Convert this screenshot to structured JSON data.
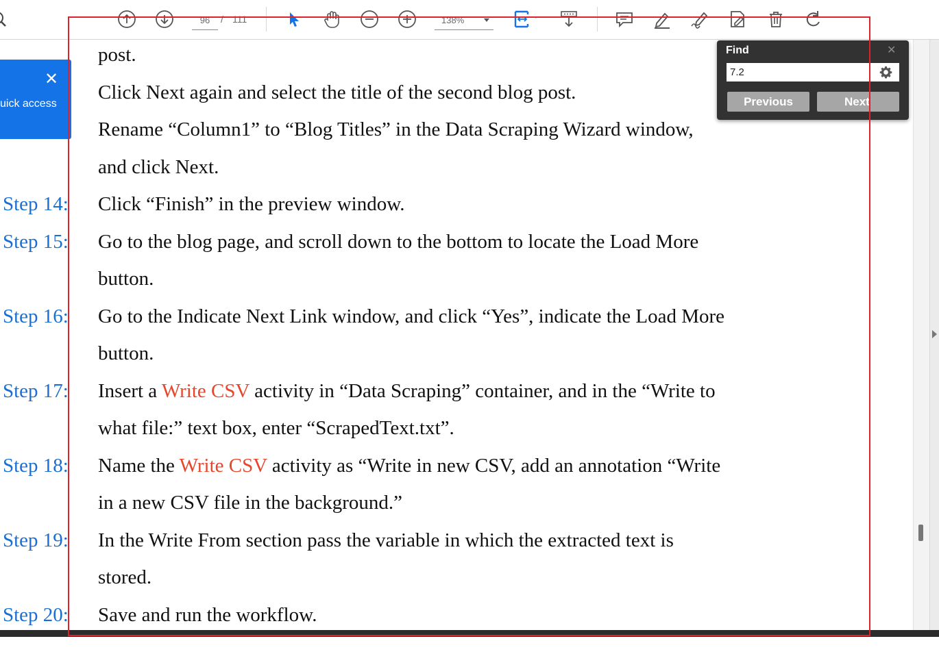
{
  "toolbar": {
    "page_current": "96",
    "page_separator": "/",
    "page_total": "111",
    "zoom_value": "138%",
    "icons": [
      "search-icon",
      "prev-page-icon",
      "next-page-icon",
      "select-tool-icon",
      "hand-tool-icon",
      "zoom-out-icon",
      "zoom-in-icon",
      "fit-page-icon",
      "scroll-mode-icon",
      "comment-icon",
      "highlight-icon",
      "draw-icon",
      "edit-pdf-icon",
      "delete-icon",
      "undo-icon"
    ]
  },
  "quick_access": {
    "label": "uick access",
    "close_glyph": "✕"
  },
  "find": {
    "title": "Find",
    "close_glyph": "✕",
    "query": "7.2",
    "previous_label": "Previous",
    "next_label": "Next"
  },
  "document": {
    "accent_color": "#1a6fd1",
    "highlight_color": "#e8462b",
    "lines": [
      "post.",
      "Click Next again and select the title of the second blog post.",
      "Rename “Column1” to “Blog Titles” in the Data Scraping Wizard window,",
      "and click Next.",
      "Click “Finish” in the preview window.",
      "Go to the blog page, and scroll down to the bottom to locate the Load More",
      "button.",
      "Go to the Indicate Next Link window, and click “Yes”, indicate the Load More",
      "button.",
      "what file:” text box, enter “ScrapedText.txt”.",
      "in a new CSV file in the background.”",
      "In the Write From section pass the variable in which the extracted text is",
      "stored.",
      "Save and run the workflow."
    ],
    "line17": {
      "before": "Insert a ",
      "highlight": "Write CSV",
      "after": " activity in “Data Scraping” container, and in the “Write to"
    },
    "line18": {
      "before": "Name the ",
      "highlight": "Write CSV",
      "after": " activity as “Write in new CSV, add an annotation “Write"
    },
    "steps": [
      "Step 14:",
      "Step 15:",
      "Step 16:",
      "Step 17:",
      "Step 18:",
      "Step 19:",
      "Step 20:"
    ]
  }
}
